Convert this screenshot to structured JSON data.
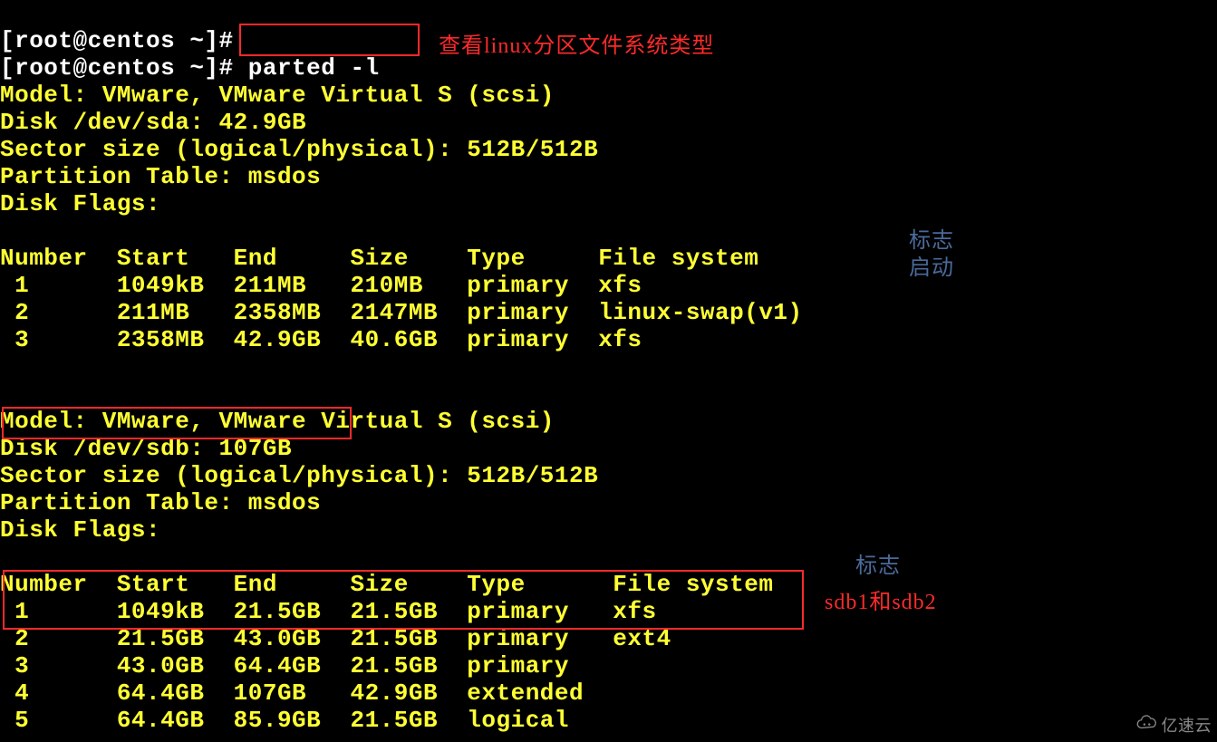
{
  "prompt1": "[root@centos ~]#",
  "prompt2_pre": "[root@centos ~]# ",
  "command": "parted -l",
  "annotation_cmd": "查看linux分区文件系统类型",
  "annotation_flag": "标志",
  "annotation_boot": "启动",
  "annotation_flag2": "标志",
  "annotation_sdb": "sdb1和sdb2",
  "disk_a": {
    "model": "Model: VMware, VMware Virtual S (scsi)",
    "disk": "Disk /dev/sda: 42.9GB",
    "sector": "Sector size (logical/physical): 512B/512B",
    "ptable": "Partition Table: msdos",
    "dflags": "Disk Flags:",
    "header": "Number  Start   End     Size    Type     File system    ",
    "rows": [
      " 1      1049kB  211MB   210MB   primary  xfs            ",
      " 2      211MB   2358MB  2147MB  primary  linux-swap(v1)",
      " 3      2358MB  42.9GB  40.6GB  primary  xfs"
    ]
  },
  "disk_b": {
    "model": "Model: VMware, VMware Virtual S (scsi)",
    "disk": "Disk /dev/sdb: 107GB",
    "sector": "Sector size (logical/physical): 512B/512B",
    "ptable": "Partition Table: msdos",
    "dflags": "Disk Flags:",
    "header": "Number  Start   End     Size    Type      File system  ",
    "rows": [
      " 1      1049kB  21.5GB  21.5GB  primary   xfs",
      " 2      21.5GB  43.0GB  21.5GB  primary   ext4",
      " 3      43.0GB  64.4GB  21.5GB  primary",
      " 4      64.4GB  107GB   42.9GB  extended",
      " 5      64.4GB  85.9GB  21.5GB  logical"
    ]
  },
  "watermark": "亿速云"
}
